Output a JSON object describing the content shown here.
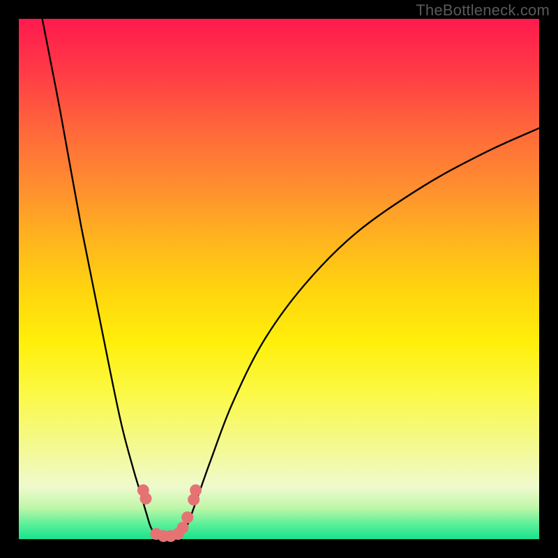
{
  "watermark": "TheBottleneck.com",
  "chart_data": {
    "type": "line",
    "title": "",
    "xlabel": "",
    "ylabel": "",
    "description": "Bottleneck curve chart with vertical rainbow gradient background (red at top through yellow to green at bottom). Two black curves descend into a V / U shape near x≈0.28 reaching the bottom (y≈0). Small pink/salmon marker dots cluster near the valley.",
    "x_range": [
      0,
      1
    ],
    "y_range": [
      0,
      1
    ],
    "series": [
      {
        "name": "left-branch",
        "x": [
          0.045,
          0.08,
          0.12,
          0.16,
          0.195,
          0.22,
          0.235,
          0.245,
          0.255,
          0.27
        ],
        "y": [
          1.0,
          0.82,
          0.6,
          0.4,
          0.23,
          0.135,
          0.085,
          0.05,
          0.02,
          0.003
        ]
      },
      {
        "name": "right-branch",
        "x": [
          0.31,
          0.325,
          0.345,
          0.37,
          0.41,
          0.47,
          0.55,
          0.65,
          0.78,
          0.9,
          1.0
        ],
        "y": [
          0.003,
          0.03,
          0.085,
          0.155,
          0.26,
          0.38,
          0.49,
          0.59,
          0.68,
          0.745,
          0.79
        ]
      }
    ],
    "markers": {
      "name": "valley-points",
      "color": "#e57373",
      "points": [
        {
          "x": 0.239,
          "y": 0.094
        },
        {
          "x": 0.244,
          "y": 0.078
        },
        {
          "x": 0.264,
          "y": 0.01
        },
        {
          "x": 0.278,
          "y": 0.006
        },
        {
          "x": 0.292,
          "y": 0.006
        },
        {
          "x": 0.306,
          "y": 0.01
        },
        {
          "x": 0.315,
          "y": 0.022
        },
        {
          "x": 0.324,
          "y": 0.042
        },
        {
          "x": 0.336,
          "y": 0.076
        },
        {
          "x": 0.34,
          "y": 0.094
        }
      ]
    },
    "background_gradient": {
      "direction": "top-to-bottom",
      "stops": [
        {
          "pos": 0.0,
          "color": "#ff1a4e"
        },
        {
          "pos": 0.5,
          "color": "#ffe00a"
        },
        {
          "pos": 0.9,
          "color": "#efface"
        },
        {
          "pos": 1.0,
          "color": "#18e28f"
        }
      ]
    }
  }
}
